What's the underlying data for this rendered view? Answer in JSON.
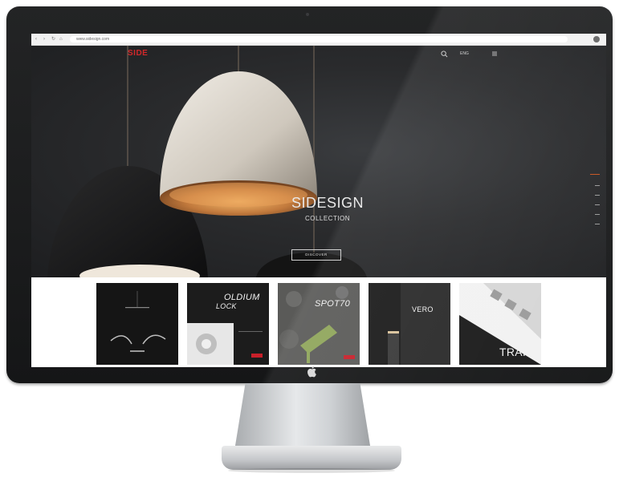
{
  "browser": {
    "url": "www.sidesign.com"
  },
  "site": {
    "logo": "SIDE",
    "nav": {
      "language": "ENG",
      "search_icon": "search-icon",
      "menu_icon": "menu-icon"
    }
  },
  "hero": {
    "title": "SIDESIGN",
    "subtitle": "COLLECTION",
    "button_label": "DISCOVER",
    "slide_count": 6
  },
  "catalogs": [
    {
      "name": "",
      "label": ""
    },
    {
      "name": "OLDIUM",
      "label": "LOCK"
    },
    {
      "name": "SPOT70",
      "label": ""
    },
    {
      "name": "VERO",
      "label": ""
    },
    {
      "name": "TRAIL",
      "label": ""
    }
  ],
  "colors": {
    "brand_red": "#d2282a",
    "hero_background": "#2a2b2d"
  }
}
